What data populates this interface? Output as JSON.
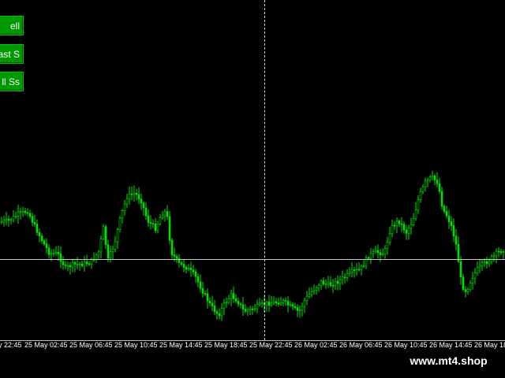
{
  "buttons": [
    {
      "label": "ell"
    },
    {
      "label": "ast S"
    },
    {
      "label": "ll Ss"
    }
  ],
  "time_axis": [
    "y 22:45",
    "25 May 02:45",
    "25 May 06:45",
    "25 May 10:45",
    "25 May 14:45",
    "25 May 18:45",
    "25 May 22:45",
    "26 May 02:45",
    "26 May 06:45",
    "26 May 10:45",
    "26 May 14:45",
    "26 May 18:"
  ],
  "watermark": "www.mt4.shop",
  "colors": {
    "background": "#000000",
    "candle": "#00e000",
    "button": "#009900",
    "crosshair": "#d0d0d0"
  }
}
